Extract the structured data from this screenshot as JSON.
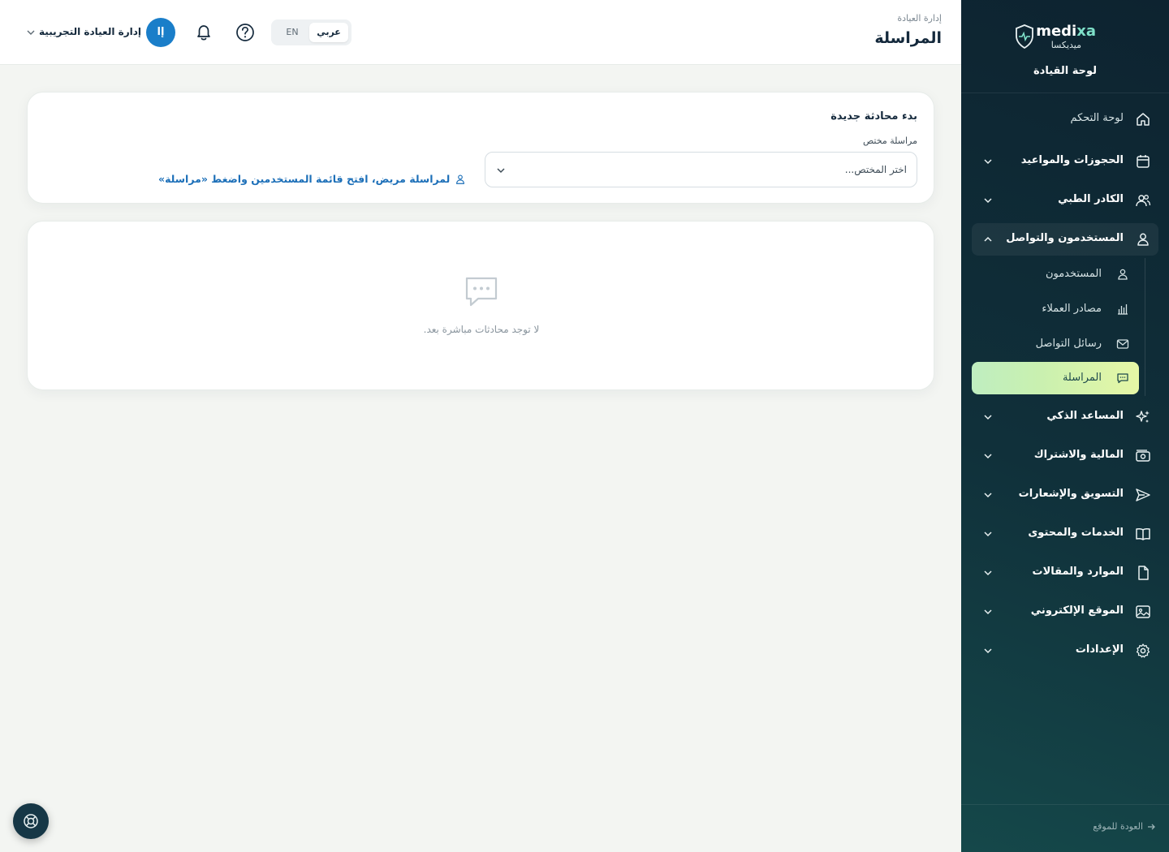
{
  "brand": {
    "name_main": "medi",
    "name_accent": "xa",
    "name_ar": "ميديكسا",
    "dashboard_title": "لوحة القيادة"
  },
  "sidebar": {
    "items": [
      {
        "label": "لوحة التحكم",
        "icon": "home-icon"
      },
      {
        "label": "الحجوزات والمواعيد",
        "icon": "calendar-icon"
      },
      {
        "label": "الكادر الطبي",
        "icon": "users-icon"
      },
      {
        "label": "المستخدمون والتواصل",
        "icon": "user-icon"
      },
      {
        "label": "المساعد الذكي",
        "icon": "sparkles-icon"
      },
      {
        "label": "المالية والاشتراك",
        "icon": "money-icon"
      },
      {
        "label": "التسويق والإشعارات",
        "icon": "send-icon"
      },
      {
        "label": "الخدمات والمحتوى",
        "icon": "book-icon"
      },
      {
        "label": "الموارد والمقالات",
        "icon": "file-icon"
      },
      {
        "label": "الموقع الإلكتروني",
        "icon": "image-icon"
      },
      {
        "label": "الإعدادات",
        "icon": "gear-icon"
      }
    ],
    "sub_items": [
      {
        "label": "المستخدمون",
        "icon": "user-icon"
      },
      {
        "label": "مصادر العملاء",
        "icon": "bar-chart-icon"
      },
      {
        "label": "رسائل التواصل",
        "icon": "mail-icon"
      },
      {
        "label": "المراسلة",
        "icon": "chat-icon"
      }
    ],
    "back_link": "العودة للموقع"
  },
  "header": {
    "breadcrumb": "إدارة العيادة",
    "title": "المراسلة",
    "lang_ar": "عربي",
    "lang_en": "EN",
    "user_initial": "إا",
    "user_name": "إدارة العيادة التجريبية"
  },
  "new_chat": {
    "title": "بدء محادثة جديدة",
    "label": "مراسلة مختص",
    "placeholder": "اختر المختص...",
    "hint": "لمراسلة مريض، افتح قائمة المستخدمين واضغط «مراسلة»"
  },
  "conversations": {
    "empty_text": "لا توجد محادثات مباشرة بعد."
  },
  "colors": {
    "sidebar_bg": "#0d2330",
    "accent_blue": "#1a7ec9",
    "active_green": "#c9f0b0"
  }
}
